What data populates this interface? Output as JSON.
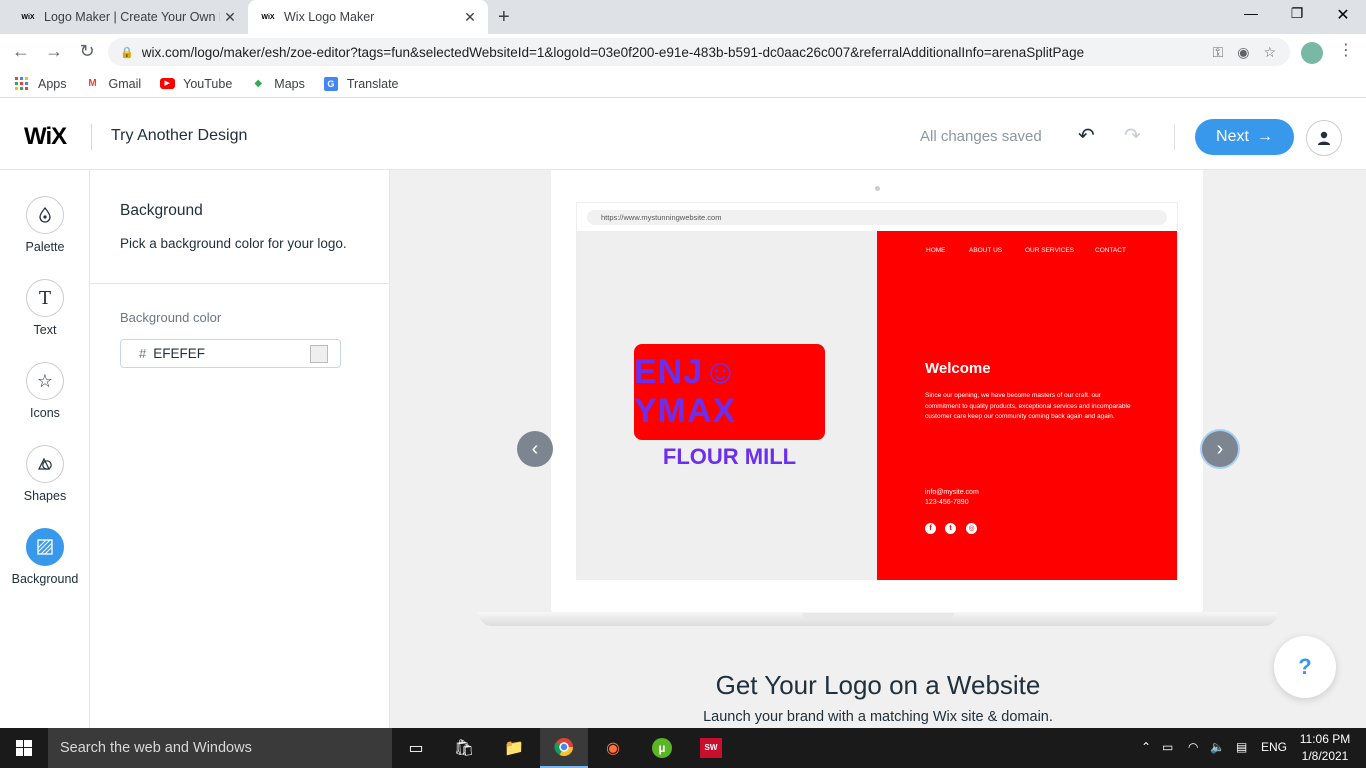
{
  "browser": {
    "tabs": [
      {
        "favicon": "WiX",
        "title": "Logo Maker | Create Your Own Fr"
      },
      {
        "favicon": "WiX",
        "title": "Wix Logo Maker"
      }
    ],
    "url": "wix.com/logo/maker/esh/zoe-editor?tags=fun&selectedWebsiteId=1&logoId=03e0f200-e91e-483b-b591-dc0aac26c007&referralAdditionalInfo=arenaSplitPage",
    "bookmarks": [
      "Apps",
      "Gmail",
      "YouTube",
      "Maps",
      "Translate"
    ]
  },
  "header": {
    "logo": "WiX",
    "try_another": "Try Another Design",
    "saved_status": "All changes saved",
    "next_label": "Next"
  },
  "sidebar": {
    "items": [
      {
        "label": "Palette",
        "icon": "palette-drop-icon"
      },
      {
        "label": "Text",
        "icon": "text-t-icon"
      },
      {
        "label": "Icons",
        "icon": "star-icon"
      },
      {
        "label": "Shapes",
        "icon": "shapes-icon"
      },
      {
        "label": "Background",
        "icon": "background-icon"
      }
    ]
  },
  "panel": {
    "title": "Background",
    "description": "Pick a background color for your logo.",
    "color_label": "Background color",
    "hash": "#",
    "hex_value": "EFEFEF",
    "swatch_color": "#EFEFEF"
  },
  "preview": {
    "mock_url": "https://www.mystunningwebsite.com",
    "logo_main": "ENJ☺YMAX",
    "logo_sub": "FLOUR MILL",
    "nav": [
      "HOME",
      "ABOUT US",
      "OUR SERVICES",
      "CONTACT"
    ],
    "welcome": "Welcome",
    "body": "Since our opening, we have become masters of our craft. our commitment to quality products, exceptional services and incomparable customer care keep our community coming back again and again.",
    "email": "info@mysite.com",
    "phone": "123-456-7890",
    "cta_title": "Get Your Logo on a Website",
    "cta_sub": "Launch your brand with a matching Wix site & domain.",
    "help": "?"
  },
  "taskbar": {
    "search_placeholder": "Search the web and Windows",
    "lang": "ENG",
    "time": "11:06 PM",
    "date": "1/8/2021"
  },
  "colors": {
    "accent": "#3899ec",
    "logo_bg": "#ff0000",
    "logo_text": "#6b2ff0"
  }
}
